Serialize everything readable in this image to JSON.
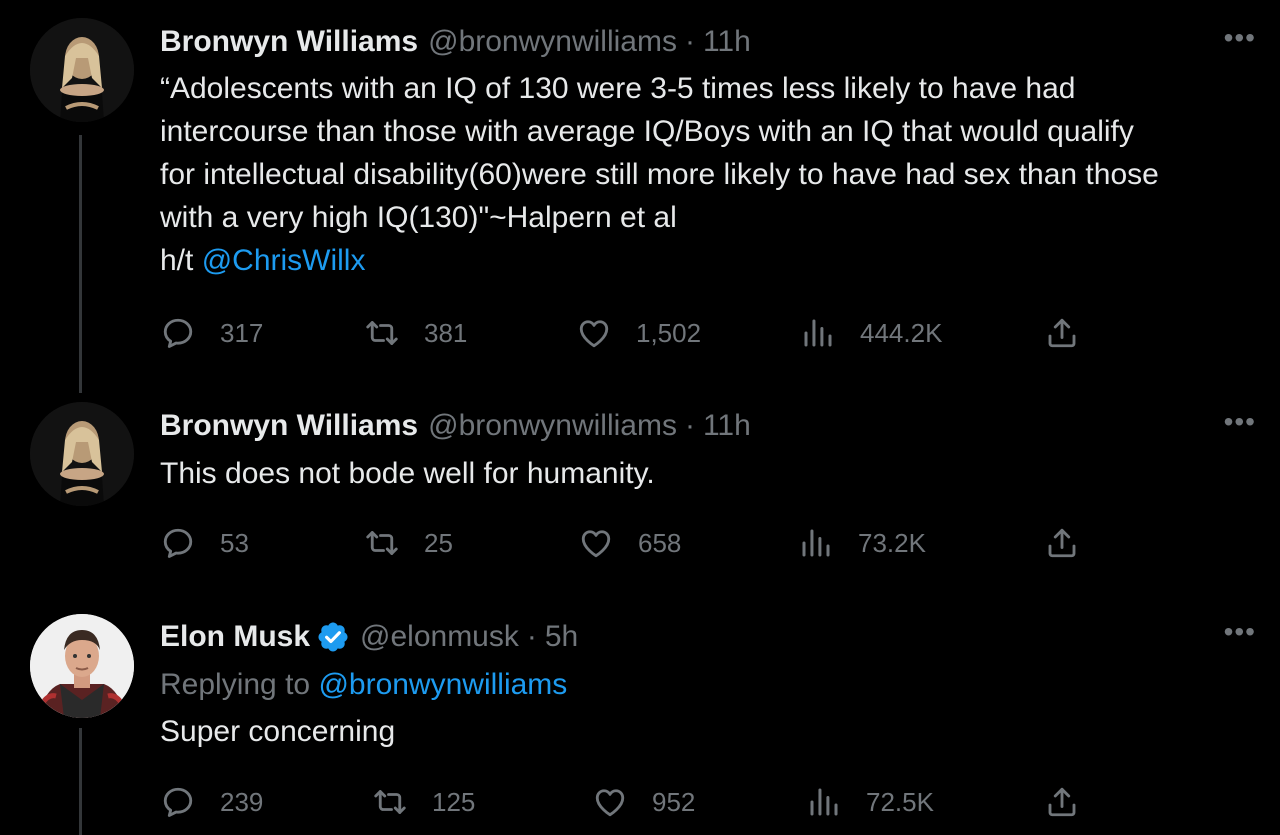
{
  "tweets": [
    {
      "author_name": "Bronwyn Williams",
      "handle": "@bronwynwilliams",
      "separator": "·",
      "time": "11h",
      "more": "•••",
      "text_lines": [
        "“Adolescents with an IQ of 130 were 3-5 times less likely to have had",
        "intercourse than those with average IQ/Boys with an IQ that would qualify",
        "for intellectual disability(60)were still more likely to have had sex than those",
        "with a very high IQ(130)\"~Halpern et al"
      ],
      "ht_prefix": "h/t",
      "ht_mention": "@ChrisWillx",
      "replies": "317",
      "retweets": "381",
      "likes": "1,502",
      "views": "444.2K"
    },
    {
      "author_name": "Bronwyn Williams",
      "handle": "@bronwynwilliams",
      "separator": "·",
      "time": "11h",
      "more": "•••",
      "text": "This does not bode well for humanity.",
      "replies": "53",
      "retweets": "25",
      "likes": "658",
      "views": "73.2K"
    },
    {
      "author_name": "Elon Musk",
      "verified": true,
      "handle": "@elonmusk",
      "separator": "·",
      "time": "5h",
      "more": "•••",
      "replying_prefix": "Replying to",
      "replying_mention": "@bronwynwilliams",
      "text": "Super concerning",
      "replies": "239",
      "retweets": "125",
      "likes": "952",
      "views": "72.5K"
    }
  ],
  "icons": {
    "reply": "reply-icon",
    "retweet": "retweet-icon",
    "like": "like-icon",
    "views": "views-icon",
    "share": "share-icon",
    "verified": "verified-badge-icon",
    "more": "more-options-icon"
  },
  "colors": {
    "background": "#000000",
    "text": "#e7e9ea",
    "muted": "#71767b",
    "link": "#1d9bf0",
    "verified": "#1d9bf0"
  }
}
